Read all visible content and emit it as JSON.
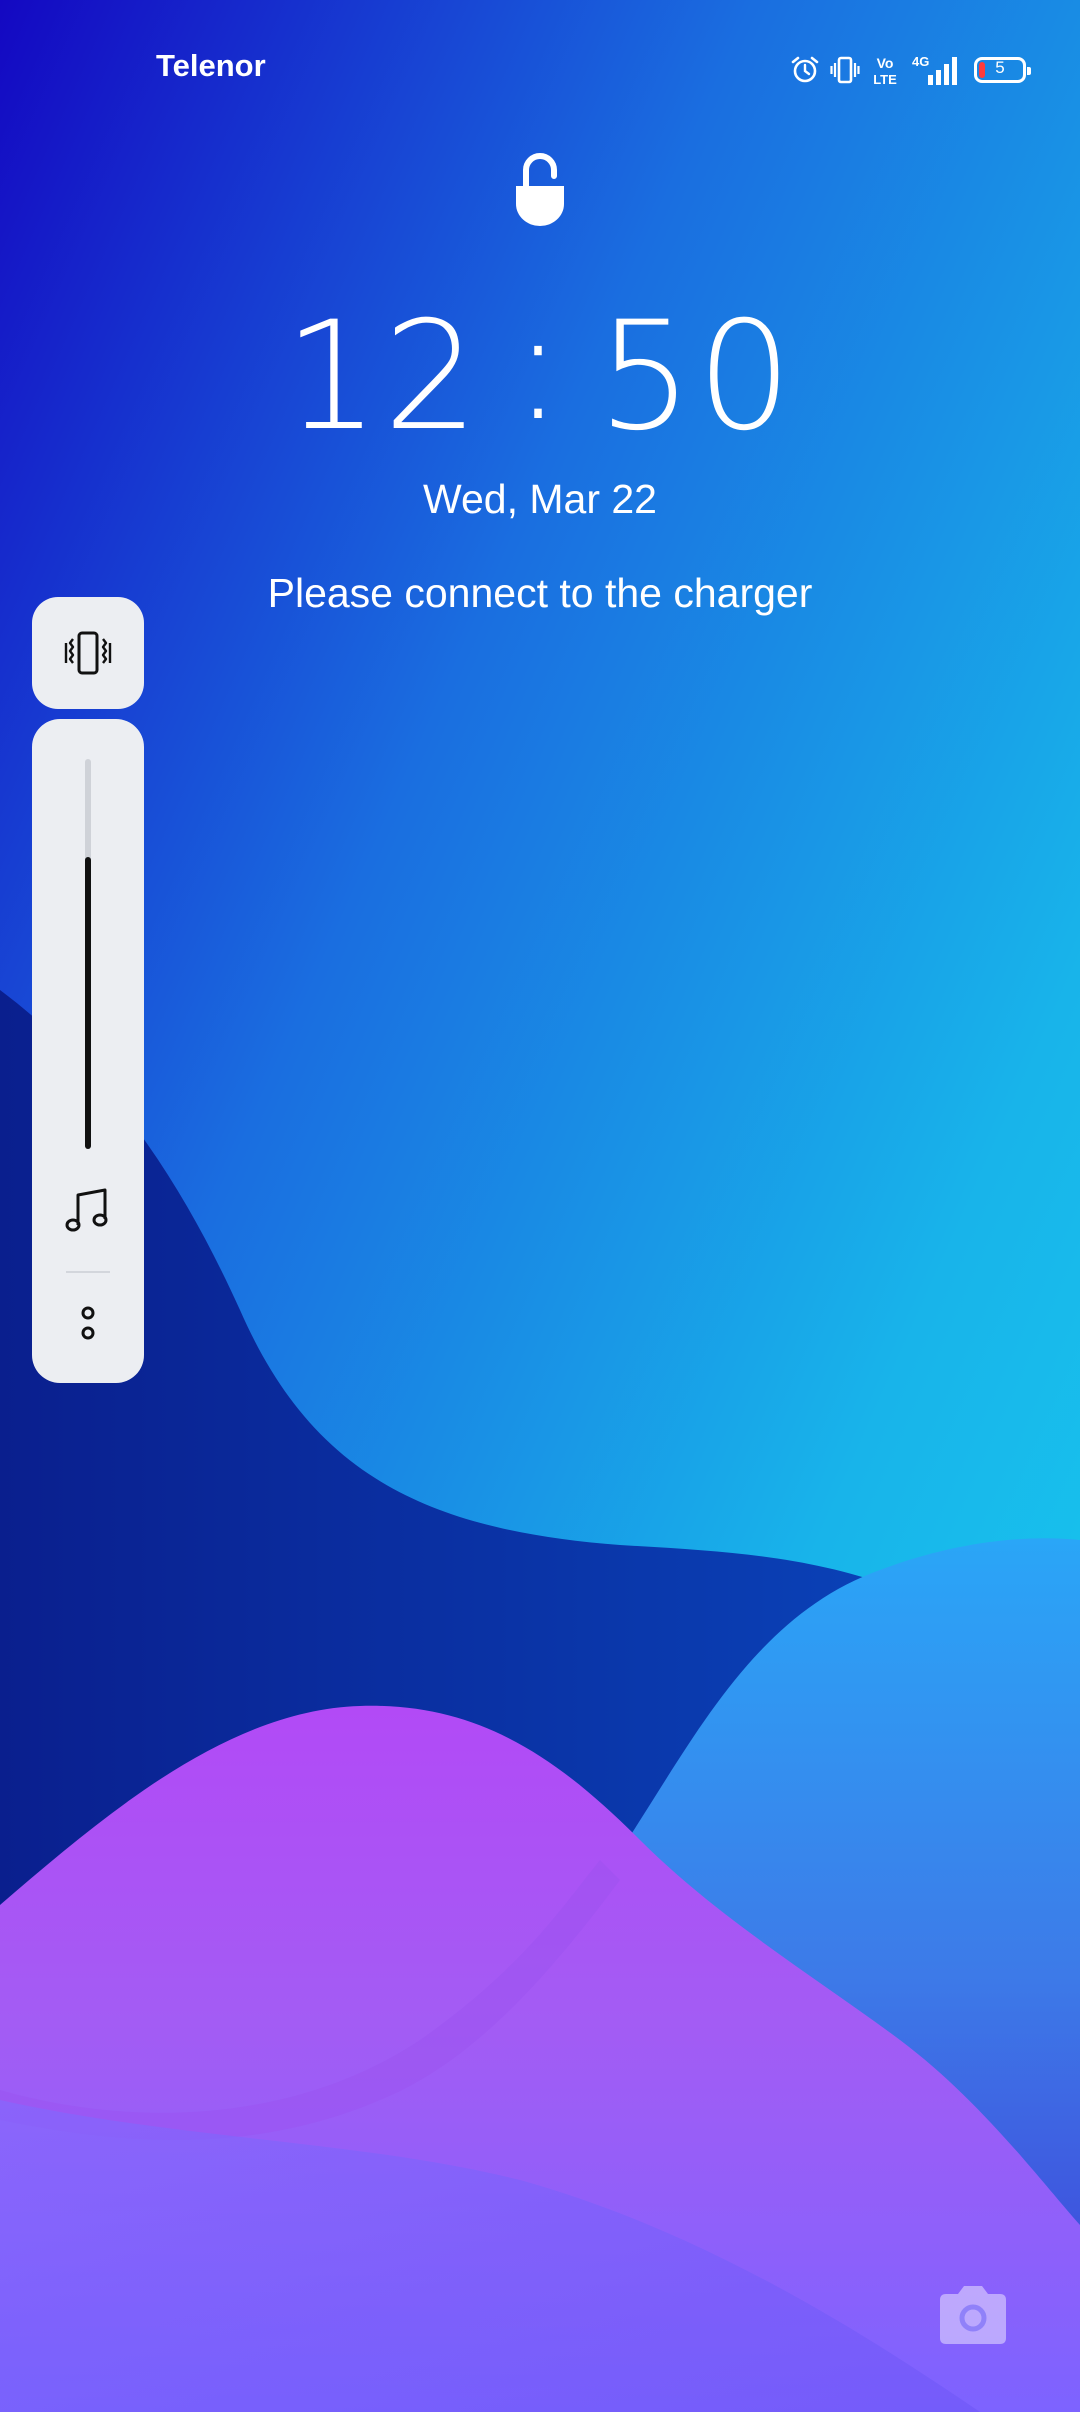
{
  "status_bar": {
    "carrier": "Telenor",
    "network": "4G",
    "volte_top": "Vo",
    "volte_bottom": "LTE",
    "battery_level": "5",
    "icons": [
      "alarm-icon",
      "vibrate-icon",
      "volte-icon",
      "signal-4g-icon",
      "battery-icon"
    ]
  },
  "lockscreen": {
    "hours": "12",
    "separator": ":",
    "minutes": "50",
    "date": "Wed, Mar 22",
    "message": "Please connect to the charger"
  },
  "volume_panel": {
    "mode_icon": "vibrate-icon",
    "stream_icon": "music-note-icon",
    "level_percent": 75,
    "more_icon": "more-options-icon"
  },
  "shortcuts": {
    "camera_icon": "camera-icon"
  },
  "colors": {
    "wallpaper_top": "#1408c2",
    "wallpaper_cyan": "#16c8ee",
    "wallpaper_navy": "#0b2c98",
    "wallpaper_purple": "#b34cf5",
    "panel_bg": "#eceef2",
    "slider_fill": "#111111"
  }
}
